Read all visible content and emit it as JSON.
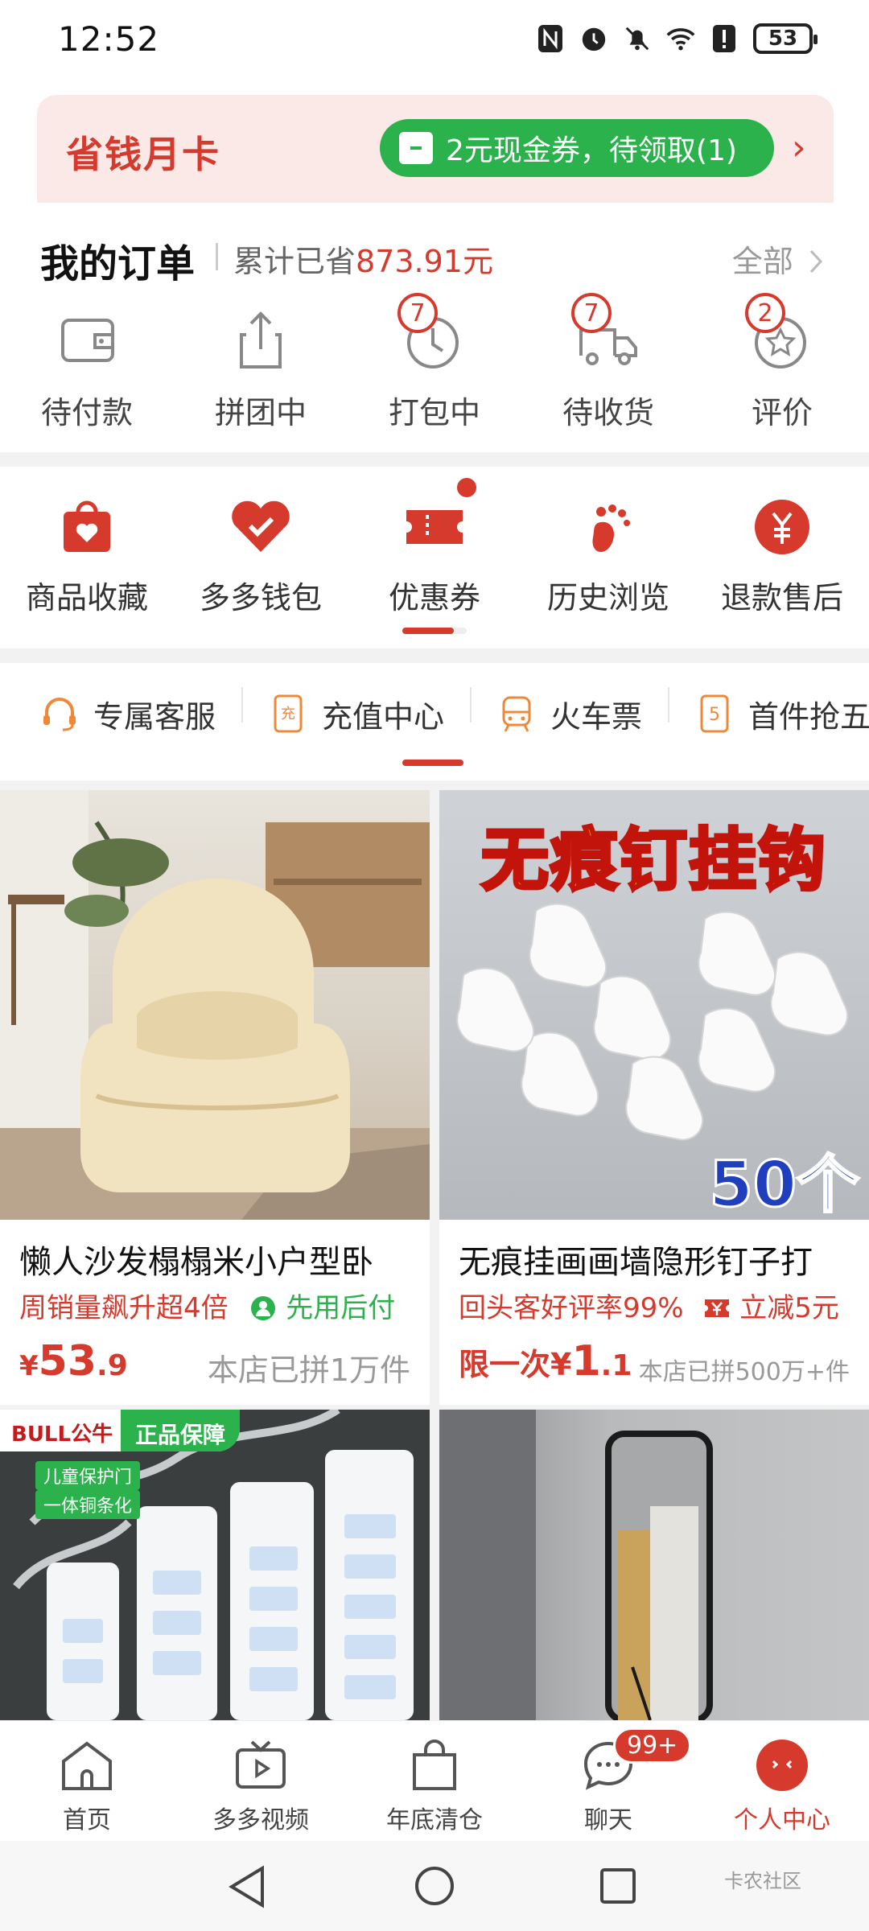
{
  "status_bar": {
    "time": "12:52",
    "battery": "53"
  },
  "month_card": {
    "title": "省钱月卡",
    "coupon_text": "2元现金券，待领取(1)",
    "chevron": "›"
  },
  "orders": {
    "title": "我的订单",
    "saved_prefix": "累计已省",
    "saved_amount": "873.91元",
    "all_label": "全部",
    "items": [
      {
        "label": "待付款",
        "icon": "wallet-icon"
      },
      {
        "label": "拼团中",
        "icon": "share-box-icon"
      },
      {
        "label": "打包中",
        "icon": "clock-icon",
        "badge": "7"
      },
      {
        "label": "待收货",
        "icon": "truck-icon",
        "badge": "7"
      },
      {
        "label": "评价",
        "icon": "star-badge-icon",
        "badge": "2"
      }
    ]
  },
  "shortcuts": {
    "items": [
      {
        "label": "商品收藏",
        "icon": "heart-bag-icon"
      },
      {
        "label": "多多钱包",
        "icon": "heart-check-icon"
      },
      {
        "label": "优惠券",
        "icon": "ticket-icon"
      },
      {
        "label": "历史浏览",
        "icon": "footprint-icon"
      },
      {
        "label": "退款售后",
        "icon": "yuan-circle-icon"
      }
    ]
  },
  "services": {
    "items": [
      {
        "label": "专属客服",
        "icon": "headset-icon"
      },
      {
        "label": "充值中心",
        "icon": "recharge-icon"
      },
      {
        "label": "火车票",
        "icon": "train-icon"
      },
      {
        "label": "首件抢五折",
        "icon": "five-icon"
      }
    ]
  },
  "products": [
    {
      "title": "懒人沙发榻榻米小户型卧",
      "tag1": "周销量飙升超4倍",
      "tag2": "先用后付",
      "price_symbol": "¥",
      "price_int": "53",
      "price_dec": ".9",
      "sold": "本店已拼1万件"
    },
    {
      "title": "无痕挂画画墙隐形钉子打",
      "image_text": "无痕钉挂钩",
      "image_count": "50个",
      "tag1": "回头客好评率99%",
      "tag2": "立减5元",
      "price_prefix": "限一次",
      "price_symbol": "¥",
      "price_int": "1",
      "price_dec": ".1",
      "sold": "本店已拼500万+件"
    },
    {
      "image_brand": "BULL公牛",
      "image_badge": "正品保障",
      "image_line1": "儿童保护门",
      "image_line2": "一体铜条化"
    },
    {}
  ],
  "bottom_nav": {
    "items": [
      {
        "label": "首页",
        "icon": "home-icon"
      },
      {
        "label": "多多视频",
        "icon": "tv-play-icon"
      },
      {
        "label": "年底清仓",
        "icon": "shopping-bag-icon"
      },
      {
        "label": "聊天",
        "icon": "chat-icon",
        "badge": "99+"
      },
      {
        "label": "个人中心",
        "icon": "profile-face-icon",
        "active": true
      }
    ]
  },
  "watermark": "卡农社区",
  "colors": {
    "accent": "#d63a2c",
    "green": "#2bb24c"
  }
}
